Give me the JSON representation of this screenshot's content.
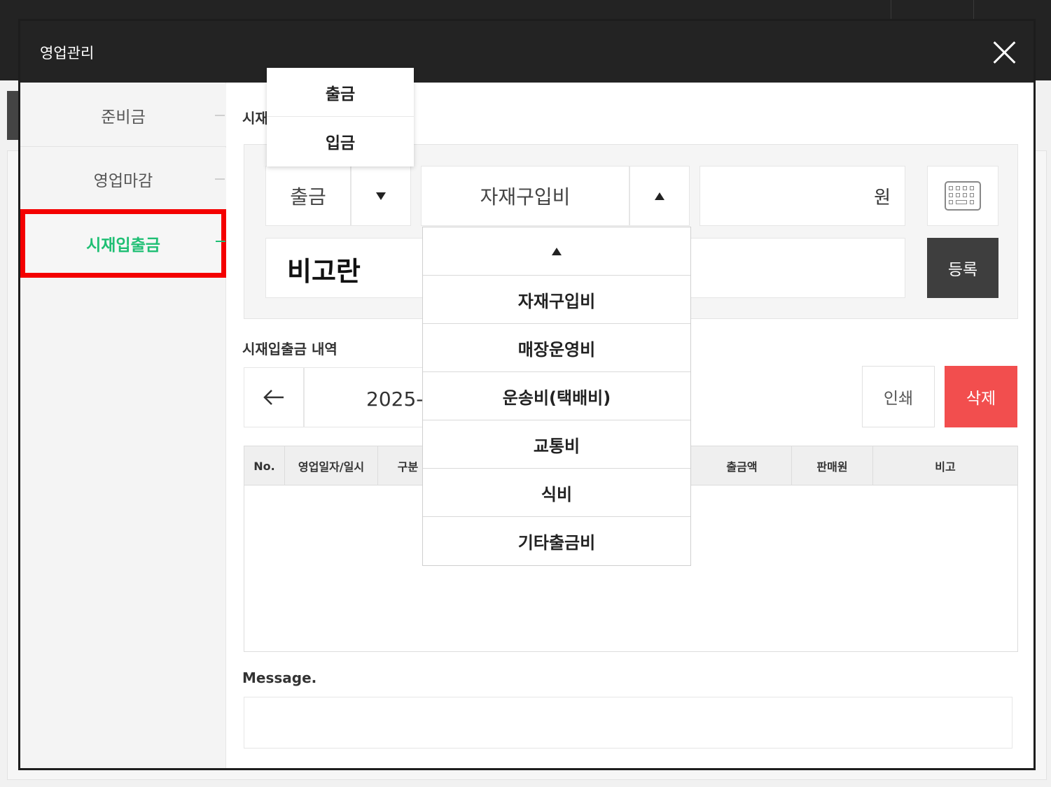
{
  "modal": {
    "title": "영업관리"
  },
  "sidebar": {
    "items": [
      {
        "label": "준비금"
      },
      {
        "label": "영업마감"
      },
      {
        "label": "시재입출금"
      }
    ]
  },
  "form": {
    "section_title": "시재",
    "type_select_value": "출금",
    "category_select_value": "자재구입비",
    "amount_unit": "원",
    "memo_label": "비고란",
    "register_label": "등록"
  },
  "type_dropdown": {
    "options": [
      "출금",
      "입금"
    ]
  },
  "category_dropdown": {
    "options": [
      "자재구입비",
      "매장운영비",
      "운송비(택배비)",
      "교통비",
      "식비",
      "기타출금비"
    ]
  },
  "history": {
    "section_title": "시재입출금 내역",
    "date_value": "2025-",
    "print_label": "인쇄",
    "delete_label": "삭제",
    "columns": [
      "No.",
      "영업일자/일시",
      "구분",
      "출금액",
      "판매원",
      "비고"
    ]
  },
  "message": {
    "label": "Message."
  }
}
